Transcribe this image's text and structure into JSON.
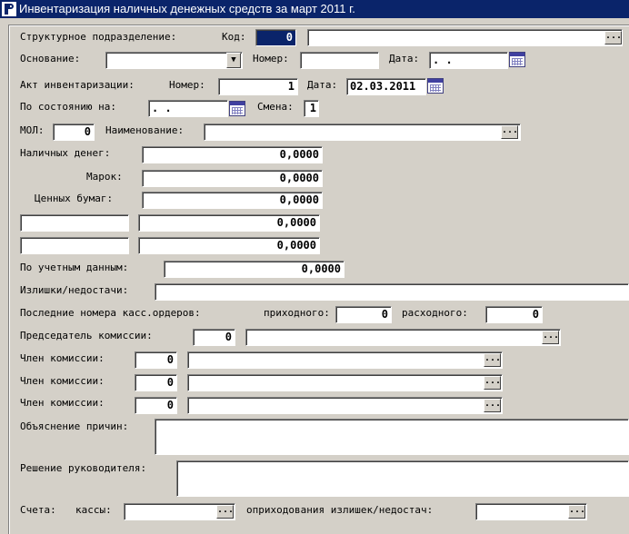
{
  "window": {
    "title": "Инвентаризация наличных денежных средств за март 2011 г."
  },
  "form": {
    "struct_label": "Структурное подразделение:",
    "code_label": "Код:",
    "code_value": "0",
    "basis_label": "Основание:",
    "number_label": "Номер:",
    "date_label": "Дата:",
    "empty_date": " .  .",
    "act_label": "Акт инвентаризации:",
    "act_number_label": "Номер:",
    "act_number": "1",
    "act_date_label": "Дата:",
    "act_date": "02.03.2011",
    "state_label": "По состоянию на:",
    "state_date": " .  .",
    "shift_label": "Смена:",
    "shift_value": "1",
    "mol_label": "МОЛ:",
    "mol_value": "0",
    "name_label": "Наименование:",
    "cash_label": "Наличных денег:",
    "cash_value": "0,0000",
    "stamps_label": "Марок:",
    "stamps_value": "0,0000",
    "securities_label": "Ценных бумаг:",
    "securities_value": "0,0000",
    "extra1_value": "0,0000",
    "extra2_value": "0,0000",
    "accounting_label": "По учетным данным:",
    "accounting_value": "0,0000",
    "surplus_label": "Излишки/недостачи:",
    "last_orders_label": "Последние номера касс.ордеров:",
    "incoming_label": "приходного:",
    "incoming_value": "0",
    "outgoing_label": "расходного:",
    "outgoing_value": "0",
    "chairman_label": "Председатель комиссии:",
    "chairman_value": "0",
    "member_label": "Член комиссии:",
    "member1_value": "0",
    "member2_value": "0",
    "member3_value": "0",
    "explanation_label": "Объяснение причин:",
    "decision_label": "Решение руководителя:",
    "accounts_label": "Счета:",
    "cashbox_label": "кассы:",
    "posting_label": "оприходования излишек/недостач:",
    "ellipsis": "...",
    "dropdown_arrow": "▼"
  }
}
